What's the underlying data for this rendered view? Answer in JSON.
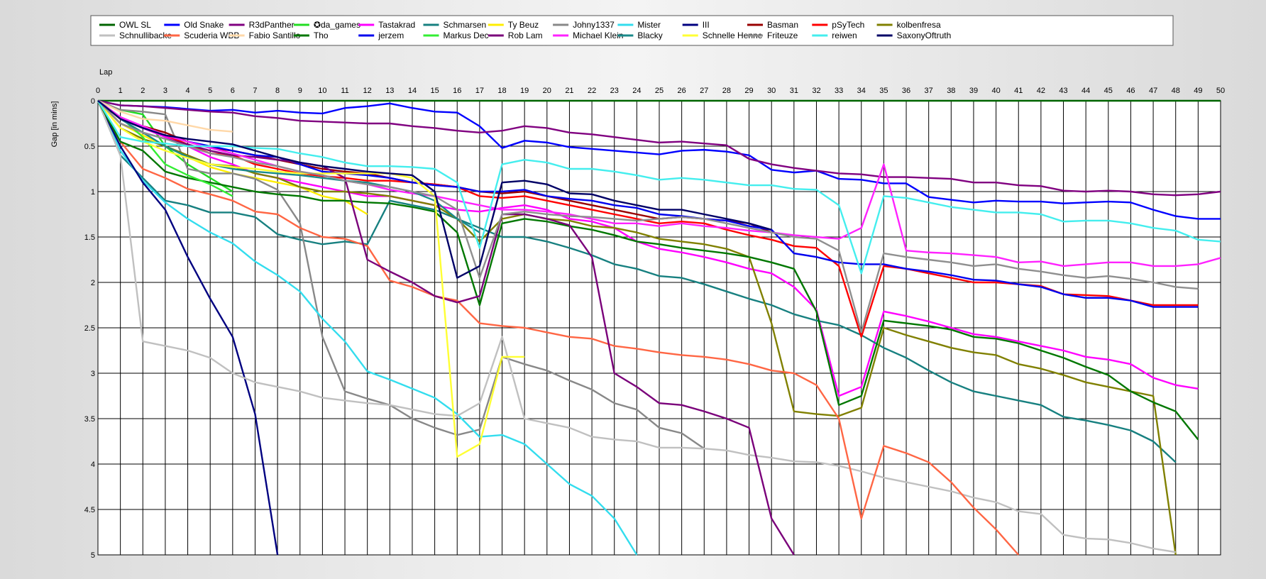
{
  "chart_data": {
    "type": "line",
    "title": "",
    "xlabel": "Lap",
    "ylabel": "Gap [in mins]",
    "x": [
      0,
      1,
      2,
      3,
      4,
      5,
      6,
      7,
      8,
      9,
      10,
      11,
      12,
      13,
      14,
      15,
      16,
      17,
      18,
      19,
      20,
      21,
      22,
      23,
      24,
      25,
      26,
      27,
      28,
      29,
      30,
      31,
      32,
      33,
      34,
      35,
      36,
      37,
      38,
      39,
      40,
      41,
      42,
      43,
      44,
      45,
      46,
      47,
      48,
      49,
      50
    ],
    "xlim": [
      0,
      50
    ],
    "ylim": [
      0,
      5
    ],
    "y_inverted": true,
    "y_ticks": [
      "0",
      "0.5",
      "1",
      "1.5",
      "2",
      "2.5",
      "3",
      "3.5",
      "4",
      "4.5",
      "5"
    ],
    "grid": true,
    "legend_position": "top",
    "series": [
      {
        "name": "OWL SL",
        "color": "#006400",
        "values": [
          0,
          0,
          0,
          0,
          0,
          0,
          0,
          0,
          0,
          0,
          0,
          0,
          0,
          0,
          0,
          0,
          0,
          0,
          0,
          0,
          0,
          0,
          0,
          0,
          0,
          0,
          0,
          0,
          0,
          0,
          0,
          0,
          0,
          0,
          0,
          0,
          0,
          0,
          0,
          0,
          0,
          0,
          0,
          0,
          0,
          0,
          0,
          0,
          0,
          0,
          0
        ]
      },
      {
        "name": "Old Snake",
        "color": "#0000ff",
        "values": [
          0,
          0.05,
          0.06,
          0.07,
          0.09,
          0.11,
          0.1,
          0.13,
          0.11,
          0.13,
          0.14,
          0.08,
          0.06,
          0.03,
          0.08,
          0.12,
          0.13,
          0.28,
          0.52,
          0.44,
          0.46,
          0.51,
          0.53,
          0.55,
          0.57,
          0.59,
          0.55,
          0.54,
          0.56,
          0.6,
          0.76,
          0.79,
          0.77,
          0.86,
          0.87,
          0.91,
          0.91,
          1.06,
          1.09,
          1.12,
          1.1,
          1.11,
          1.11,
          1.13,
          1.12,
          1.11,
          1.12,
          1.2,
          1.27,
          1.3,
          1.3
        ]
      },
      {
        "name": "R3dPanther",
        "color": "#800080",
        "values": [
          0,
          0.05,
          0.06,
          0.08,
          0.1,
          0.12,
          0.13,
          0.17,
          0.19,
          0.22,
          0.23,
          0.24,
          0.25,
          0.25,
          0.28,
          0.3,
          0.33,
          0.35,
          0.33,
          0.28,
          0.3,
          0.35,
          0.37,
          0.4,
          0.43,
          0.46,
          0.45,
          0.47,
          0.49,
          0.64,
          0.7,
          0.74,
          0.77,
          0.8,
          0.81,
          0.84,
          0.84,
          0.85,
          0.86,
          0.9,
          0.9,
          0.93,
          0.94,
          0.99,
          1.0,
          0.99,
          1.0,
          1.03,
          1.04,
          1.03,
          1.0
        ]
      },
      {
        "name": "✪da_games",
        "color": "#22dd22",
        "values": [
          0,
          0.1,
          0.15,
          0.5,
          0.7,
          0.85,
          1.0
        ]
      },
      {
        "name": "Tastakrad",
        "color": "#ff00ff",
        "values": [
          0,
          0.18,
          0.3,
          0.4,
          0.5,
          0.62,
          0.7,
          0.8,
          0.85,
          0.9,
          0.95,
          1.0,
          1.05,
          1.05,
          1.1,
          1.15,
          1.2,
          1.22,
          1.18,
          1.15,
          1.2,
          1.3,
          1.33,
          1.4,
          1.55,
          1.63,
          1.67,
          1.72,
          1.78,
          1.85,
          1.9,
          2.05,
          2.3,
          3.25,
          3.15,
          2.32,
          2.37,
          2.43,
          2.5,
          2.57,
          2.6,
          2.65,
          2.7,
          2.75,
          2.82,
          2.85,
          2.9,
          3.05,
          3.13,
          3.17
        ]
      },
      {
        "name": "Schmarsen",
        "color": "#178080",
        "values": [
          0,
          0.6,
          0.85,
          1.1,
          1.15,
          1.23,
          1.23,
          1.28,
          1.47,
          1.53,
          1.58,
          1.55,
          1.58,
          1.1,
          1.15,
          1.2,
          1.3,
          1.4,
          1.5,
          1.5,
          1.55,
          1.62,
          1.7,
          1.8,
          1.85,
          1.93,
          1.95,
          2.02,
          2.1,
          2.18,
          2.25,
          2.35,
          2.42,
          2.47,
          2.58,
          2.72,
          2.83,
          2.97,
          3.1,
          3.2,
          3.25,
          3.3,
          3.35,
          3.48,
          3.52,
          3.57,
          3.63,
          3.75,
          3.98
        ]
      },
      {
        "name": "Ty Beuz",
        "color": "#ffee00",
        "values": [
          0,
          0.25,
          0.38,
          0.5,
          0.62,
          0.73,
          0.8,
          0.85,
          0.9,
          0.95,
          1.05,
          1.1,
          1.25
        ]
      },
      {
        "name": "Johny1337",
        "color": "#888888",
        "values": [
          0,
          0.1,
          0.12,
          0.15,
          0.75,
          0.8,
          0.8,
          0.86,
          0.98,
          1.35,
          2.6,
          3.2,
          3.28,
          3.35,
          3.5,
          3.6,
          3.68,
          3.62,
          2.82,
          2.9,
          2.97,
          3.08,
          3.18,
          3.33,
          3.4,
          3.6,
          3.66,
          3.83
        ]
      },
      {
        "name": "Mister",
        "color": "#33ddee",
        "values": [
          0,
          0.55,
          0.88,
          1.12,
          1.3,
          1.45,
          1.57,
          1.77,
          1.92,
          2.1,
          2.4,
          2.65,
          2.98,
          3.07,
          3.17,
          3.27,
          3.45,
          3.7,
          3.68,
          3.78,
          4.0,
          4.22,
          4.35,
          4.6,
          5.0
        ]
      },
      {
        "name": "III",
        "color": "#000080",
        "values": [
          0,
          0.5,
          0.9,
          1.2,
          1.72,
          2.18,
          2.6,
          3.45,
          5.0
        ]
      },
      {
        "name": "Basman",
        "color": "#990000",
        "values": [
          0,
          0.2,
          0.28,
          0.35,
          0.45,
          0.52,
          0.55,
          0.6,
          0.65,
          0.7,
          0.75,
          0.78,
          0.8,
          0.85,
          0.9,
          0.92,
          0.95,
          1.0,
          1.02,
          1.0,
          1.05,
          1.1,
          1.15,
          1.2,
          1.25,
          1.3,
          1.28,
          1.3,
          1.32,
          1.35,
          1.45
        ]
      },
      {
        "name": "pSyTech",
        "color": "#ff0000",
        "values": [
          0,
          0.2,
          0.3,
          0.38,
          0.48,
          0.58,
          0.6,
          0.7,
          0.75,
          0.8,
          0.83,
          0.85,
          0.88,
          0.88,
          0.9,
          0.92,
          0.95,
          1.05,
          1.07,
          1.05,
          1.1,
          1.15,
          1.2,
          1.25,
          1.3,
          1.35,
          1.33,
          1.35,
          1.42,
          1.48,
          1.53,
          1.6,
          1.62,
          1.82,
          2.6,
          1.82,
          1.85,
          1.9,
          1.95,
          2.0,
          2.0,
          2.02,
          2.04,
          2.13,
          2.14,
          2.15,
          2.2,
          2.25,
          2.25,
          2.25
        ]
      },
      {
        "name": "kolbenfresa",
        "color": "#808000",
        "values": [
          0,
          0.3,
          0.42,
          0.5,
          0.6,
          0.7,
          0.72,
          0.8,
          0.85,
          0.95,
          1.0,
          1.0,
          1.02,
          1.05,
          1.1,
          1.15,
          1.3,
          1.55,
          1.3,
          1.25,
          1.3,
          1.32,
          1.38,
          1.4,
          1.45,
          1.52,
          1.55,
          1.58,
          1.63,
          1.72,
          2.45,
          3.42,
          3.45,
          3.47,
          3.38,
          2.5,
          2.58,
          2.65,
          2.72,
          2.77,
          2.8,
          2.9,
          2.95,
          3.02,
          3.1,
          3.15,
          3.2,
          3.25,
          5.0
        ]
      },
      {
        "name": "Schnullibacke",
        "color": "#c0c0c0",
        "values": [
          0,
          0.6,
          2.65,
          2.7,
          2.75,
          2.83,
          3.0,
          3.1,
          3.15,
          3.2,
          3.27,
          3.3,
          3.33,
          3.35,
          3.4,
          3.45,
          3.47,
          3.33,
          2.6,
          3.5,
          3.55,
          3.6,
          3.7,
          3.73,
          3.75,
          3.82,
          3.82,
          3.83,
          3.85,
          3.9,
          3.93,
          3.97,
          3.98,
          4.02,
          4.08,
          4.15,
          4.2,
          4.25,
          4.3,
          4.37,
          4.42,
          4.52,
          4.55,
          4.78,
          4.82,
          4.83,
          4.87,
          4.93,
          4.97
        ]
      },
      {
        "name": "Scuderia WBB",
        "color": "#ff6644",
        "values": [
          0,
          0.45,
          0.75,
          0.85,
          0.97,
          1.03,
          1.1,
          1.22,
          1.25,
          1.4,
          1.5,
          1.52,
          1.6,
          1.98,
          2.05,
          2.15,
          2.2,
          2.45,
          2.48,
          2.5,
          2.55,
          2.6,
          2.62,
          2.7,
          2.73,
          2.77,
          2.8,
          2.82,
          2.85,
          2.9,
          2.97,
          3.0,
          3.13,
          3.5,
          4.6,
          3.8,
          3.88,
          3.98,
          4.2,
          4.48,
          4.72,
          5.0
        ]
      },
      {
        "name": "Fabio Santillo",
        "color": "#ffd8a8",
        "values": [
          0,
          0.12,
          0.2,
          0.22,
          0.27,
          0.32,
          0.34
        ]
      },
      {
        "name": "Tho",
        "color": "#007700",
        "values": [
          0,
          0.45,
          0.55,
          0.78,
          0.85,
          0.9,
          0.95,
          1.0,
          1.03,
          1.05,
          1.1,
          1.1,
          1.12,
          1.13,
          1.17,
          1.22,
          1.45,
          2.25,
          1.35,
          1.3,
          1.33,
          1.38,
          1.42,
          1.48,
          1.55,
          1.58,
          1.62,
          1.65,
          1.68,
          1.72,
          1.78,
          1.85,
          2.32,
          3.35,
          3.25,
          2.42,
          2.45,
          2.48,
          2.52,
          2.6,
          2.62,
          2.67,
          2.75,
          2.83,
          2.93,
          3.02,
          3.2,
          3.32,
          3.42,
          3.73
        ]
      },
      {
        "name": "jerzem",
        "color": "#0000ee",
        "values": [
          0,
          0.2,
          0.3,
          0.38,
          0.45,
          0.5,
          0.55,
          0.6,
          0.62,
          0.7,
          0.78,
          0.8,
          0.82,
          0.85,
          0.9,
          0.93,
          0.95,
          1.0,
          1.0,
          0.98,
          1.05,
          1.08,
          1.1,
          1.15,
          1.18,
          1.25,
          1.27,
          1.3,
          1.32,
          1.38,
          1.42,
          1.68,
          1.72,
          1.78,
          1.8,
          1.8,
          1.85,
          1.88,
          1.92,
          1.97,
          1.98,
          2.02,
          2.05,
          2.13,
          2.17,
          2.17,
          2.2,
          2.27,
          2.27,
          2.27
        ]
      },
      {
        "name": "Markus Dec",
        "color": "#33ee33",
        "values": [
          0,
          0.18,
          0.4,
          0.7,
          0.82,
          0.92,
          1.05
        ]
      },
      {
        "name": "Rob Lam",
        "color": "#7a007a",
        "values": [
          0,
          0.25,
          0.35,
          0.42,
          0.48,
          0.55,
          0.6,
          0.62,
          0.65,
          0.68,
          0.72,
          0.85,
          1.75,
          1.88,
          2.0,
          2.15,
          2.22,
          2.15,
          1.25,
          1.25,
          1.3,
          1.37,
          1.72,
          3.0,
          3.15,
          3.33,
          3.35,
          3.42,
          3.5,
          3.6,
          4.6,
          5.0
        ]
      },
      {
        "name": "Michael Klein",
        "color": "#ff22ff",
        "values": [
          0,
          0.18,
          0.28,
          0.38,
          0.45,
          0.52,
          0.58,
          0.65,
          0.72,
          0.78,
          0.82,
          0.88,
          0.92,
          0.98,
          1.02,
          1.05,
          1.1,
          1.15,
          1.2,
          1.2,
          1.22,
          1.25,
          1.3,
          1.35,
          1.35,
          1.38,
          1.35,
          1.38,
          1.4,
          1.43,
          1.45,
          1.48,
          1.5,
          1.52,
          1.4,
          0.7,
          1.65,
          1.67,
          1.68,
          1.7,
          1.72,
          1.78,
          1.77,
          1.82,
          1.8,
          1.78,
          1.78,
          1.82,
          1.82,
          1.8,
          1.73
        ]
      },
      {
        "name": "Blacky",
        "color": "#1a8a8a",
        "values": [
          0,
          0.2,
          0.35,
          0.5,
          0.62,
          0.7,
          0.75,
          0.78,
          0.8,
          0.82,
          0.85,
          0.88,
          0.9,
          0.95,
          1.0,
          1.1,
          1.3,
          1.45
        ]
      },
      {
        "name": "Schnelle Henne",
        "color": "#ffff33",
        "values": [
          0,
          0.3,
          0.45,
          0.55,
          0.63,
          0.7,
          0.73,
          0.75,
          0.78,
          0.8,
          0.8,
          0.8,
          0.8,
          0.8,
          0.85,
          1.05,
          3.92,
          3.78,
          2.82,
          2.82
        ]
      },
      {
        "name": "Friteuze",
        "color": "#8f8f8f",
        "values": [
          0,
          0.25,
          0.35,
          0.42,
          0.5,
          0.58,
          0.62,
          0.68,
          0.72,
          0.78,
          0.82,
          0.88,
          0.92,
          0.95,
          1.0,
          1.05,
          1.2,
          1.95,
          1.25,
          1.22,
          1.25,
          1.27,
          1.28,
          1.3,
          1.32,
          1.3,
          1.28,
          1.3,
          1.35,
          1.4,
          1.45,
          1.5,
          1.52,
          1.65,
          2.55,
          1.68,
          1.72,
          1.75,
          1.78,
          1.82,
          1.8,
          1.85,
          1.88,
          1.92,
          1.95,
          1.93,
          1.96,
          2.0,
          2.05,
          2.07
        ]
      },
      {
        "name": "reiwen",
        "color": "#44eeee",
        "values": [
          0,
          0.4,
          0.45,
          0.47,
          0.5,
          0.5,
          0.5,
          0.52,
          0.53,
          0.58,
          0.62,
          0.68,
          0.72,
          0.72,
          0.73,
          0.75,
          0.9,
          1.62,
          0.7,
          0.65,
          0.68,
          0.75,
          0.75,
          0.78,
          0.82,
          0.87,
          0.85,
          0.87,
          0.9,
          0.93,
          0.93,
          0.97,
          0.98,
          1.15,
          1.9,
          1.05,
          1.07,
          1.12,
          1.17,
          1.2,
          1.23,
          1.23,
          1.25,
          1.33,
          1.32,
          1.32,
          1.35,
          1.4,
          1.43,
          1.53,
          1.55
        ]
      },
      {
        "name": "SaxonyOftruth",
        "color": "#000066",
        "values": [
          0,
          0.2,
          0.3,
          0.38,
          0.42,
          0.45,
          0.48,
          0.55,
          0.62,
          0.68,
          0.72,
          0.75,
          0.78,
          0.8,
          0.82,
          1.0,
          1.95,
          1.82,
          0.9,
          0.88,
          0.92,
          1.02,
          1.03,
          1.1,
          1.15,
          1.2,
          1.2,
          1.25,
          1.3,
          1.35,
          1.42
        ]
      }
    ]
  }
}
